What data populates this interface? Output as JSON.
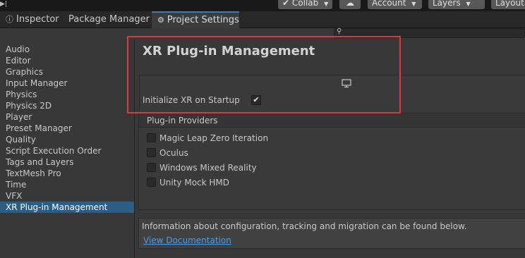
{
  "toolbar": {
    "collab_label": "Collab",
    "account_label": "Account",
    "layers_label": "Layers",
    "layout_label": "Layout"
  },
  "tabs": [
    {
      "label": "Inspector",
      "icon": "info-icon",
      "active": false
    },
    {
      "label": "Package Manager",
      "icon": "",
      "active": false
    },
    {
      "label": "Project Settings",
      "icon": "gear-icon",
      "active": true
    }
  ],
  "search": {
    "placeholder": ""
  },
  "sidebar": {
    "items": [
      {
        "label": "Audio"
      },
      {
        "label": "Editor"
      },
      {
        "label": "Graphics"
      },
      {
        "label": "Input Manager"
      },
      {
        "label": "Physics"
      },
      {
        "label": "Physics 2D"
      },
      {
        "label": "Player"
      },
      {
        "label": "Preset Manager"
      },
      {
        "label": "Quality"
      },
      {
        "label": "Script Execution Order"
      },
      {
        "label": "Tags and Layers"
      },
      {
        "label": "TextMesh Pro"
      },
      {
        "label": "Time"
      },
      {
        "label": "VFX"
      },
      {
        "label": "XR Plug-in Management",
        "selected": true
      }
    ]
  },
  "main": {
    "title": "XR Plug-in Management",
    "platform_icon": "monitor-icon",
    "initialize_label": "Initialize XR on Startup",
    "initialize_checked": true,
    "providers_title": "Plug-in Providers",
    "providers": [
      {
        "label": "Magic Leap Zero Iteration",
        "checked": false
      },
      {
        "label": "Oculus",
        "checked": false
      },
      {
        "label": "Windows Mixed Reality",
        "checked": false
      },
      {
        "label": "Unity Mock HMD",
        "checked": false
      }
    ],
    "info_text": "Information about configuration, tracking and migration can be found below.",
    "doc_link": "View Documentation"
  },
  "colors": {
    "accent": "#3a79bb",
    "selection": "#2c5d87",
    "highlight": "#e0373a",
    "link": "#4c9de6"
  }
}
